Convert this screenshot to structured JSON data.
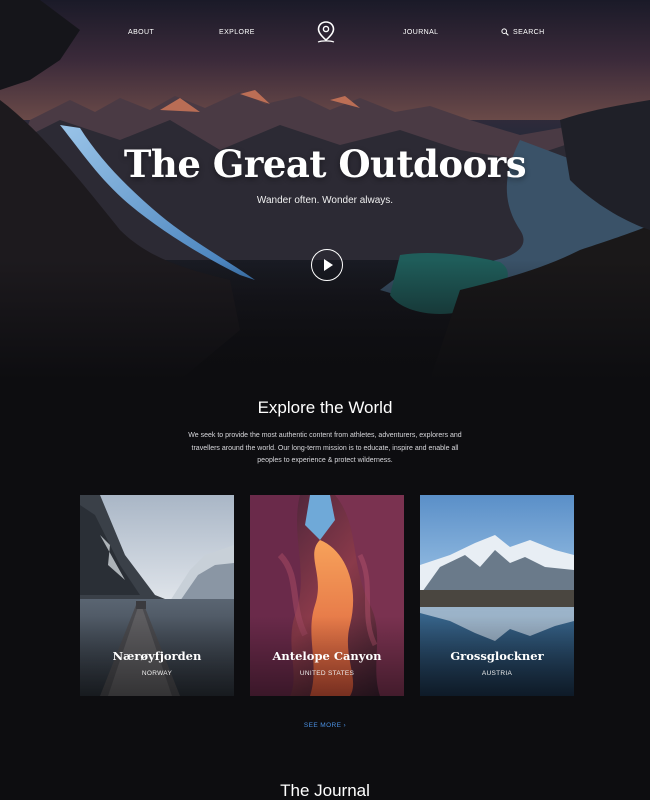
{
  "nav": {
    "about": "ABOUT",
    "explore": "EXPLORE",
    "journal": "JOURNAL",
    "search": "SEARCH",
    "logo_icon": "map-pin-icon",
    "search_icon": "search-icon"
  },
  "hero": {
    "title": "The Great Outdoors",
    "subtitle": "Wander often. Wonder always.",
    "play_icon": "play-icon"
  },
  "explore": {
    "title": "Explore the World",
    "description": "We seek to provide the most authentic content from athletes, adventurers, explorers and travellers around the world. Our long-term mission is to educate, inspire and enable all peoples to experience & protect wilderness."
  },
  "cards": [
    {
      "title": "Nærøyfjorden",
      "country": "NORWAY"
    },
    {
      "title": "Antelope Canyon",
      "country": "UNITED STATES"
    },
    {
      "title": "Grossglockner",
      "country": "AUSTRIA"
    }
  ],
  "see_more": "SEE MORE ›",
  "journal": {
    "title": "The Journal"
  },
  "colors": {
    "background": "#0d0d10",
    "accent_link": "#4a90e2",
    "text": "#ffffff"
  }
}
